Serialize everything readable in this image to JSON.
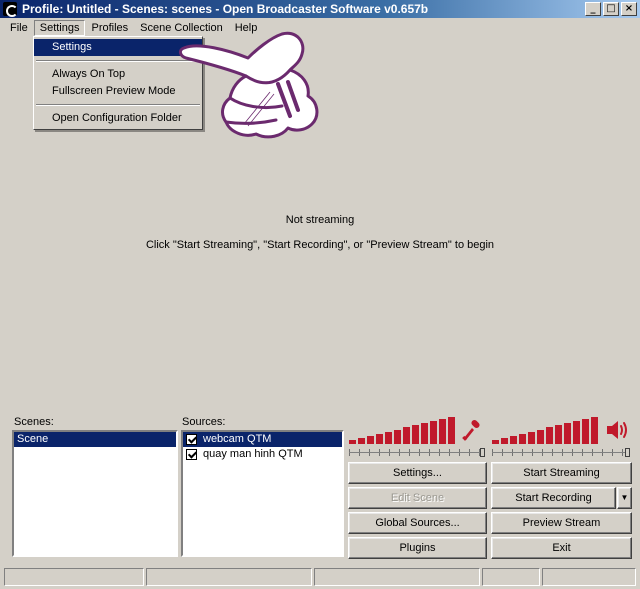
{
  "window": {
    "title": "Profile: Untitled - Scenes: scenes - Open Broadcaster Software v0.657b",
    "minimize_glyph": "_",
    "maximize_glyph": "□",
    "close_glyph": "×"
  },
  "menubar": {
    "items": [
      "File",
      "Settings",
      "Profiles",
      "Scene Collection",
      "Help"
    ]
  },
  "settings_menu": {
    "items": [
      "Settings",
      "Always On Top",
      "Fullscreen Preview Mode",
      "Open Configuration Folder"
    ]
  },
  "preview": {
    "status": "Not streaming",
    "hint": "Click \"Start Streaming\", \"Start Recording\", or \"Preview Stream\" to begin"
  },
  "scenes": {
    "label": "Scenes:",
    "items": [
      {
        "name": "Scene",
        "selected": true
      }
    ]
  },
  "sources": {
    "label": "Sources:",
    "items": [
      {
        "name": "webcam QTM",
        "checked": true,
        "selected": true
      },
      {
        "name": "quay man hinh QTM",
        "checked": true,
        "selected": false
      }
    ]
  },
  "audio": {
    "mic_icon": "microphone-icon",
    "speaker_icon": "speaker-icon",
    "meter_color": "#c0192b"
  },
  "buttons": {
    "settings": "Settings...",
    "edit_scene": "Edit Scene",
    "global_sources": "Global Sources...",
    "plugins": "Plugins",
    "start_streaming": "Start Streaming",
    "start_recording": "Start Recording",
    "preview_stream": "Preview Stream",
    "exit": "Exit"
  },
  "colors": {
    "chrome": "#d4d0c8",
    "selection": "#0a246a",
    "overlay_outline": "#6b2a6e"
  }
}
